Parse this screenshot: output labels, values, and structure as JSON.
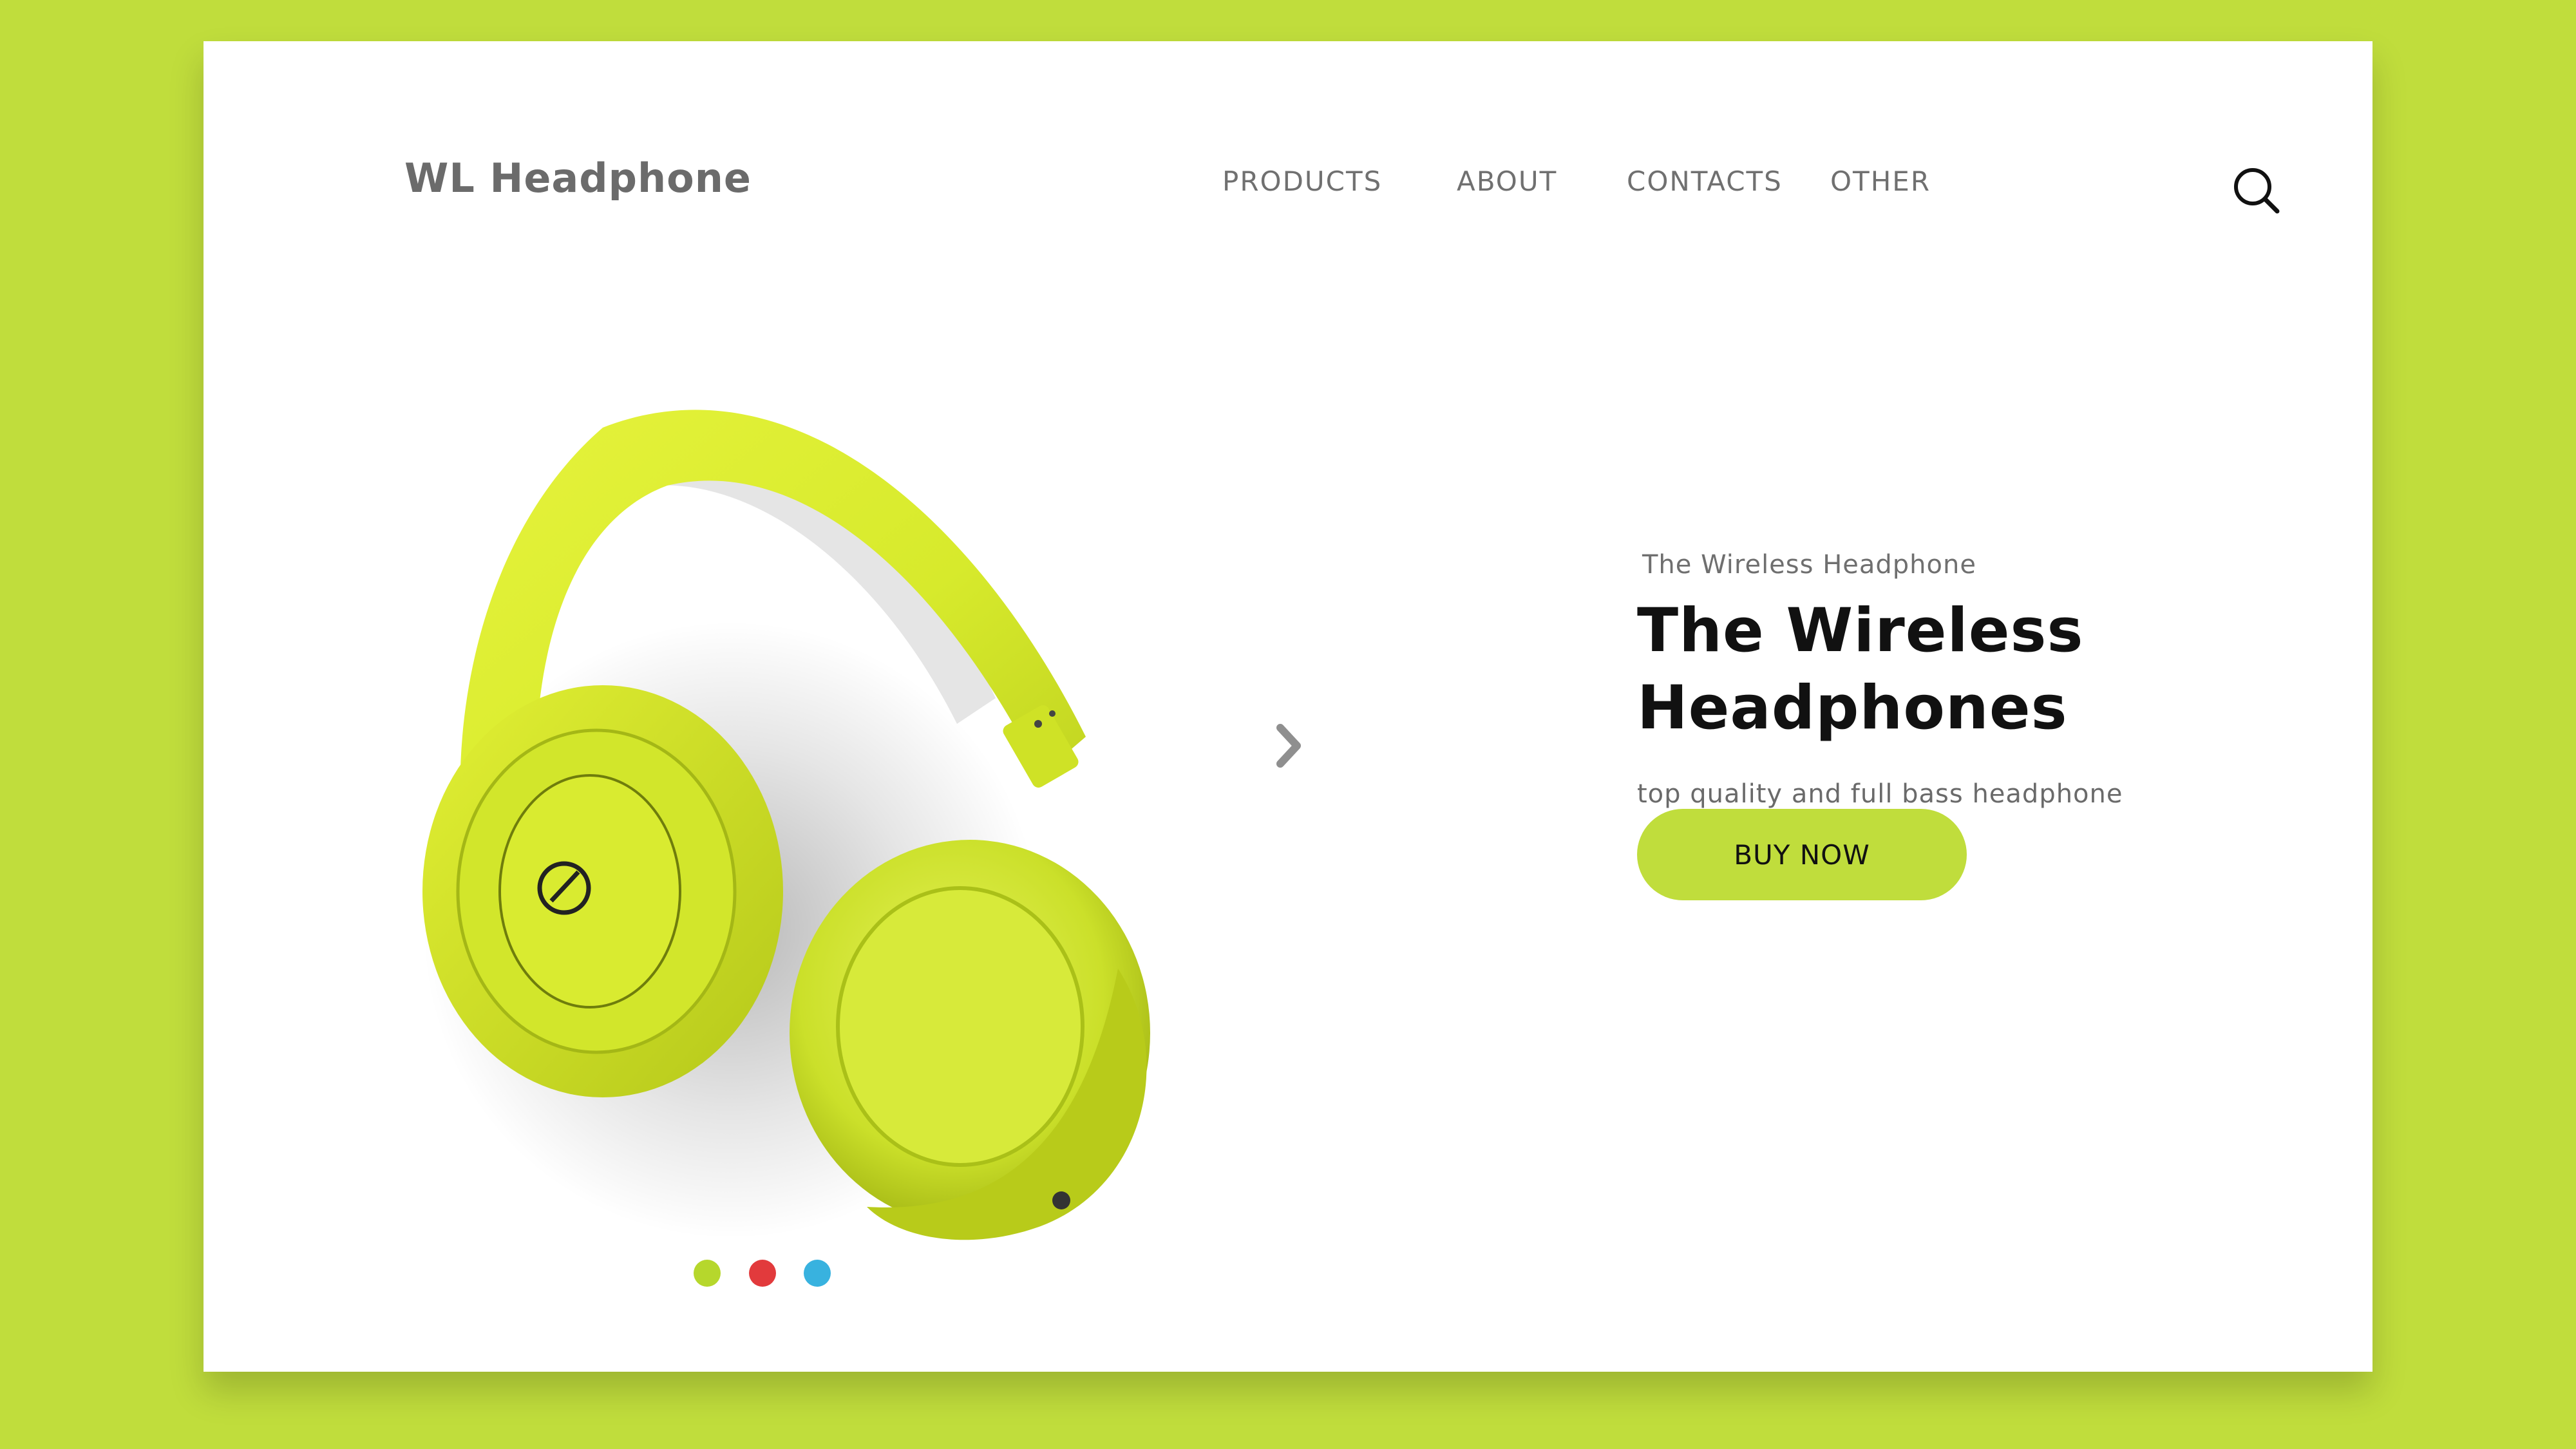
{
  "brand": {
    "name": "WL Headphone"
  },
  "nav": {
    "items": [
      {
        "label": "PRODUCTS"
      },
      {
        "label": "ABOUT"
      },
      {
        "label": "CONTACTS"
      },
      {
        "label": "OTHER"
      }
    ]
  },
  "header": {
    "search_icon": "search-icon"
  },
  "hero": {
    "image_icon": "headphones-image",
    "eyebrow": "The Wireless Headphone",
    "title_line1": "The Wireless",
    "title_line2": "Headphones",
    "subtitle": "top quality and full bass headphone",
    "cta_label": "BUY NOW",
    "next_icon": "chevron-right-icon"
  },
  "carousel": {
    "active_index": 0,
    "dots": [
      {
        "color": "#b6d72c"
      },
      {
        "color": "#e23a3c"
      },
      {
        "color": "#38b2df"
      }
    ]
  },
  "colors": {
    "background": "#c0dd3c",
    "accent": "#c0dd3c",
    "card": "#ffffff",
    "text_dark": "#111111",
    "text_muted": "#6b6b6b"
  }
}
